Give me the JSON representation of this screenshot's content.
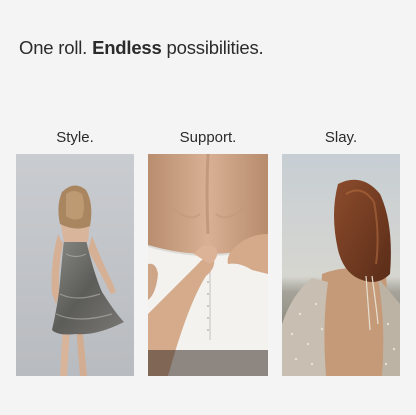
{
  "headline": {
    "part1": "One roll. ",
    "emphasis": "Endless",
    "part2": " possibilities."
  },
  "columns": [
    {
      "caption": "Style.",
      "image_alt": "Woman in sequin slip dress with bare back"
    },
    {
      "caption": "Support.",
      "image_alt": "Hands fastening back of a white strapless bodice"
    },
    {
      "caption": "Slay.",
      "image_alt": "Woman with auburn hair in open-back sequin top at the beach"
    }
  ],
  "colors": {
    "background": "#f4f4f4",
    "text": "#2b2b2b"
  }
}
